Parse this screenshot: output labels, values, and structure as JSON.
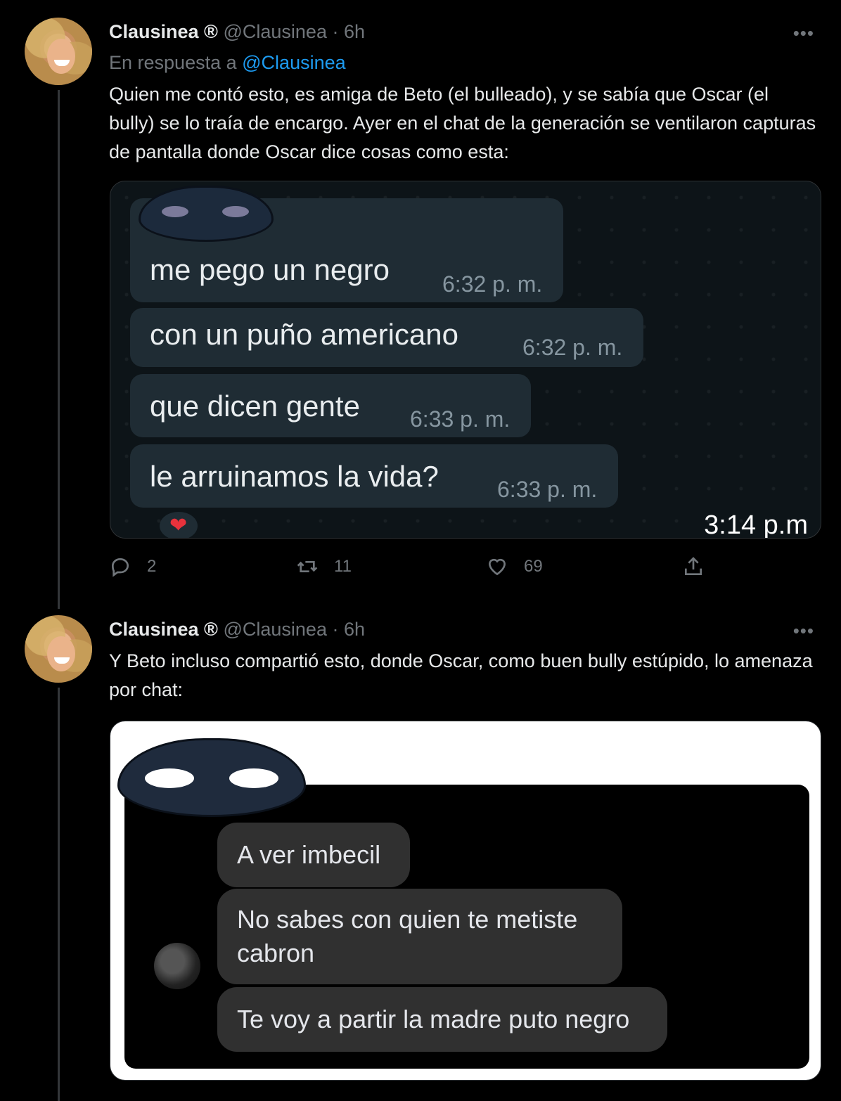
{
  "tweets": [
    {
      "author_name": "Clausinea ®",
      "handle": "@Clausinea",
      "separator": "·",
      "time": "6h",
      "more": "•••",
      "reply_prefix": "En respuesta a",
      "reply_to": "@Clausinea",
      "text": "Quien me contó esto, es amiga de Beto (el bulleado), y se sabía que Oscar (el bully) se lo traía de encargo. Ayer en el chat de la generación se ventilaron capturas de pantalla donde Oscar dice cosas como esta:",
      "media": {
        "messages": [
          {
            "text": "me pego un negro",
            "time": "6:32 p. m."
          },
          {
            "text": "con un puño americano",
            "time": "6:32 p. m."
          },
          {
            "text": "que dicen gente",
            "time": "6:33 p. m."
          },
          {
            "text": "le arruinamos la vida?",
            "time": "6:33 p. m."
          }
        ],
        "reaction": "❤",
        "clock": "3:14 p.m"
      },
      "actions": {
        "replies": "2",
        "retweets": "11",
        "likes": "69"
      }
    },
    {
      "author_name": "Clausinea ®",
      "handle": "@Clausinea",
      "separator": "·",
      "time": "6h",
      "more": "•••",
      "text": "Y Beto incluso compartió esto, donde Oscar, como buen bully estúpido, lo amenaza por chat:",
      "media": {
        "messages": [
          {
            "text": "A ver imbecil"
          },
          {
            "text": "No sabes con quien te metiste cabron"
          },
          {
            "text": "Te voy a partir la madre puto negro"
          }
        ]
      }
    }
  ],
  "icons": {
    "reply": "reply-icon",
    "retweet": "retweet-icon",
    "like": "heart-icon",
    "share": "share-icon",
    "more": "more-icon"
  },
  "colors": {
    "background": "#000000",
    "link": "#1d9bf0",
    "muted": "#71767b",
    "text": "#e7e9ea"
  }
}
